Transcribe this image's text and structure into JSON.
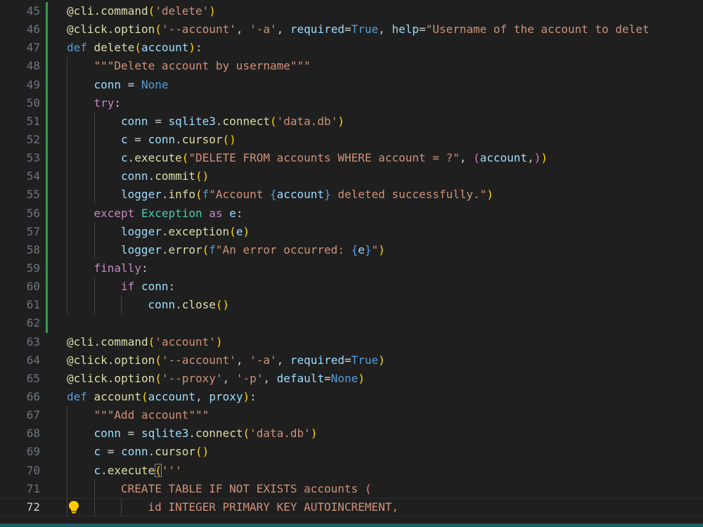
{
  "editor": {
    "language": "python",
    "current_line": 72,
    "lines": [
      {
        "n": 45,
        "indent": 0,
        "mod": "added",
        "tokens": [
          [
            "fn",
            "@cli.command"
          ],
          [
            "p1",
            "("
          ],
          [
            "str",
            "'delete'"
          ],
          [
            "p1",
            ")"
          ]
        ]
      },
      {
        "n": 46,
        "indent": 0,
        "mod": "added",
        "tokens": [
          [
            "fn",
            "@click.option"
          ],
          [
            "p1",
            "("
          ],
          [
            "str",
            "'--account'"
          ],
          [
            "plain",
            ", "
          ],
          [
            "str",
            "'-a'"
          ],
          [
            "plain",
            ", "
          ],
          [
            "var",
            "required"
          ],
          [
            "plain",
            "="
          ],
          [
            "kw",
            "True"
          ],
          [
            "plain",
            ", "
          ],
          [
            "var",
            "help"
          ],
          [
            "plain",
            "="
          ],
          [
            "str",
            "\"Username of the account to delet"
          ]
        ]
      },
      {
        "n": 47,
        "indent": 0,
        "mod": "added",
        "tokens": [
          [
            "kw",
            "def "
          ],
          [
            "fn",
            "delete"
          ],
          [
            "p1",
            "("
          ],
          [
            "var",
            "account"
          ],
          [
            "p1",
            ")"
          ],
          [
            "plain",
            ":"
          ]
        ]
      },
      {
        "n": 48,
        "indent": 1,
        "mod": "added",
        "tokens": [
          [
            "str",
            "\"\"\"Delete account by username\"\"\""
          ]
        ]
      },
      {
        "n": 49,
        "indent": 1,
        "mod": "added",
        "tokens": [
          [
            "var",
            "conn"
          ],
          [
            "plain",
            " = "
          ],
          [
            "kw",
            "None"
          ]
        ]
      },
      {
        "n": 50,
        "indent": 1,
        "mod": "added",
        "tokens": [
          [
            "ctl",
            "try"
          ],
          [
            "plain",
            ":"
          ]
        ]
      },
      {
        "n": 51,
        "indent": 2,
        "mod": "added",
        "tokens": [
          [
            "var",
            "conn"
          ],
          [
            "plain",
            " = "
          ],
          [
            "var",
            "sqlite3"
          ],
          [
            "plain",
            "."
          ],
          [
            "fn",
            "connect"
          ],
          [
            "p1",
            "("
          ],
          [
            "str",
            "'data.db'"
          ],
          [
            "p1",
            ")"
          ]
        ]
      },
      {
        "n": 52,
        "indent": 2,
        "mod": "added",
        "tokens": [
          [
            "var",
            "c"
          ],
          [
            "plain",
            " = "
          ],
          [
            "var",
            "conn"
          ],
          [
            "plain",
            "."
          ],
          [
            "fn",
            "cursor"
          ],
          [
            "p1",
            "()"
          ]
        ]
      },
      {
        "n": 53,
        "indent": 2,
        "mod": "added",
        "tokens": [
          [
            "var",
            "c"
          ],
          [
            "plain",
            "."
          ],
          [
            "fn",
            "execute"
          ],
          [
            "p1",
            "("
          ],
          [
            "str",
            "\"DELETE FROM accounts WHERE account = ?\""
          ],
          [
            "plain",
            ", "
          ],
          [
            "p2",
            "("
          ],
          [
            "var",
            "account"
          ],
          [
            "plain",
            ","
          ],
          [
            "p2",
            ")"
          ],
          [
            "p1",
            ")"
          ]
        ]
      },
      {
        "n": 54,
        "indent": 2,
        "mod": "added",
        "tokens": [
          [
            "var",
            "conn"
          ],
          [
            "plain",
            "."
          ],
          [
            "fn",
            "commit"
          ],
          [
            "p1",
            "()"
          ]
        ]
      },
      {
        "n": 55,
        "indent": 2,
        "mod": "added",
        "tokens": [
          [
            "var",
            "logger"
          ],
          [
            "plain",
            "."
          ],
          [
            "fn",
            "info"
          ],
          [
            "p1",
            "("
          ],
          [
            "kw",
            "f"
          ],
          [
            "str",
            "\"Account "
          ],
          [
            "kw",
            "{"
          ],
          [
            "var",
            "account"
          ],
          [
            "kw",
            "}"
          ],
          [
            "str",
            " deleted successfully.\""
          ],
          [
            "p1",
            ")"
          ]
        ]
      },
      {
        "n": 56,
        "indent": 1,
        "mod": "added",
        "tokens": [
          [
            "ctl",
            "except "
          ],
          [
            "cls",
            "Exception"
          ],
          [
            "ctl",
            " as "
          ],
          [
            "var",
            "e"
          ],
          [
            "plain",
            ":"
          ]
        ]
      },
      {
        "n": 57,
        "indent": 2,
        "mod": "added",
        "tokens": [
          [
            "var",
            "logger"
          ],
          [
            "plain",
            "."
          ],
          [
            "fn",
            "exception"
          ],
          [
            "p1",
            "("
          ],
          [
            "var",
            "e"
          ],
          [
            "p1",
            ")"
          ]
        ]
      },
      {
        "n": 58,
        "indent": 2,
        "mod": "added",
        "tokens": [
          [
            "var",
            "logger"
          ],
          [
            "plain",
            "."
          ],
          [
            "fn",
            "error"
          ],
          [
            "p1",
            "("
          ],
          [
            "kw",
            "f"
          ],
          [
            "str",
            "\"An error occurred: "
          ],
          [
            "kw",
            "{"
          ],
          [
            "var",
            "e"
          ],
          [
            "kw",
            "}"
          ],
          [
            "str",
            "\""
          ],
          [
            "p1",
            ")"
          ]
        ]
      },
      {
        "n": 59,
        "indent": 1,
        "mod": "added",
        "tokens": [
          [
            "ctl",
            "finally"
          ],
          [
            "plain",
            ":"
          ]
        ]
      },
      {
        "n": 60,
        "indent": 2,
        "mod": "added",
        "tokens": [
          [
            "ctl",
            "if "
          ],
          [
            "var",
            "conn"
          ],
          [
            "plain",
            ":"
          ]
        ]
      },
      {
        "n": 61,
        "indent": 3,
        "mod": "added",
        "tokens": [
          [
            "var",
            "conn"
          ],
          [
            "plain",
            "."
          ],
          [
            "fn",
            "close"
          ],
          [
            "p1",
            "()"
          ]
        ]
      },
      {
        "n": 62,
        "indent": 0,
        "mod": "added",
        "tokens": []
      },
      {
        "n": 63,
        "indent": 0,
        "mod": "",
        "tokens": [
          [
            "fn",
            "@cli.command"
          ],
          [
            "p1",
            "("
          ],
          [
            "str",
            "'account'"
          ],
          [
            "p1",
            ")"
          ]
        ]
      },
      {
        "n": 64,
        "indent": 0,
        "mod": "",
        "tokens": [
          [
            "fn",
            "@click.option"
          ],
          [
            "p1",
            "("
          ],
          [
            "str",
            "'--account'"
          ],
          [
            "plain",
            ", "
          ],
          [
            "str",
            "'-a'"
          ],
          [
            "plain",
            ", "
          ],
          [
            "var",
            "required"
          ],
          [
            "plain",
            "="
          ],
          [
            "kw",
            "True"
          ],
          [
            "p1",
            ")"
          ]
        ]
      },
      {
        "n": 65,
        "indent": 0,
        "mod": "",
        "tokens": [
          [
            "fn",
            "@click.option"
          ],
          [
            "p1",
            "("
          ],
          [
            "str",
            "'--proxy'"
          ],
          [
            "plain",
            ", "
          ],
          [
            "str",
            "'-p'"
          ],
          [
            "plain",
            ", "
          ],
          [
            "var",
            "default"
          ],
          [
            "plain",
            "="
          ],
          [
            "kw",
            "None"
          ],
          [
            "p1",
            ")"
          ]
        ]
      },
      {
        "n": 66,
        "indent": 0,
        "mod": "",
        "tokens": [
          [
            "kw",
            "def "
          ],
          [
            "fn",
            "account"
          ],
          [
            "p1",
            "("
          ],
          [
            "var",
            "account"
          ],
          [
            "plain",
            ", "
          ],
          [
            "var",
            "proxy"
          ],
          [
            "p1",
            ")"
          ],
          [
            "plain",
            ":"
          ]
        ]
      },
      {
        "n": 67,
        "indent": 1,
        "mod": "",
        "tokens": [
          [
            "str",
            "\"\"\"Add account\"\"\""
          ]
        ]
      },
      {
        "n": 68,
        "indent": 1,
        "mod": "",
        "tokens": [
          [
            "var",
            "conn"
          ],
          [
            "plain",
            " = "
          ],
          [
            "var",
            "sqlite3"
          ],
          [
            "plain",
            "."
          ],
          [
            "fn",
            "connect"
          ],
          [
            "p1",
            "("
          ],
          [
            "str",
            "'data.db'"
          ],
          [
            "p1",
            ")"
          ]
        ]
      },
      {
        "n": 69,
        "indent": 1,
        "mod": "",
        "tokens": [
          [
            "var",
            "c"
          ],
          [
            "plain",
            " = "
          ],
          [
            "var",
            "conn"
          ],
          [
            "plain",
            "."
          ],
          [
            "fn",
            "cursor"
          ],
          [
            "p1",
            "()"
          ]
        ]
      },
      {
        "n": 70,
        "indent": 1,
        "mod": "",
        "tokens": [
          [
            "var",
            "c"
          ],
          [
            "plain",
            "."
          ],
          [
            "fn",
            "execute"
          ],
          [
            "p1m",
            "("
          ],
          [
            "str",
            "'''"
          ]
        ]
      },
      {
        "n": 71,
        "indent": 2,
        "mod": "",
        "tokens": [
          [
            "str",
            "CREATE TABLE IF NOT EXISTS accounts ("
          ]
        ]
      },
      {
        "n": 72,
        "indent": 3,
        "mod": "",
        "tokens": [
          [
            "str",
            "id INTEGER PRIMARY KEY AUTOINCREMENT,"
          ]
        ]
      }
    ]
  },
  "icons": {
    "lightbulb": "lightbulb-icon"
  },
  "colors": {
    "background": "#1f1f1f",
    "added_gutter": "#2ea043",
    "lightbulb": "#ffcc00"
  }
}
